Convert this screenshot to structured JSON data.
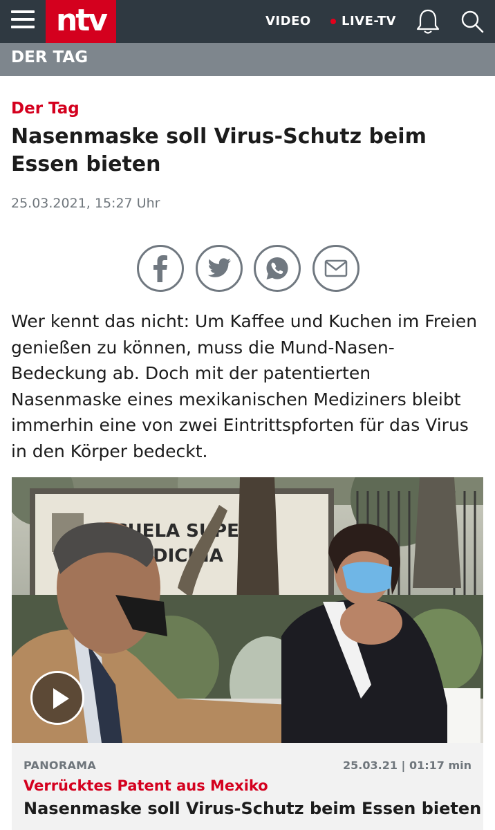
{
  "header": {
    "logo_text": "ntv",
    "nav_video": "VIDEO",
    "nav_live": "LIVE-TV",
    "colors": {
      "bar": "#2f3941",
      "brand_red": "#d4001e"
    },
    "icons": [
      "menu-icon",
      "bell-icon",
      "search-icon"
    ]
  },
  "section": {
    "label": "DER TAG"
  },
  "article": {
    "kicker": "Der Tag",
    "headline": "Nasenmaske soll Virus-Schutz beim Essen bieten",
    "date": "25.03.2021, 15:27 Uhr",
    "share_icons": [
      "facebook-icon",
      "twitter-icon",
      "whatsapp-icon",
      "mail-icon"
    ],
    "teaser": "Wer kennt das nicht: Um Kaffee und Kuchen im Freien genießen zu können, muss die Mund-Nasen-Bedeckung ab. Doch mit der patentierten Nasenmaske eines mexikanischen Mediziners bleibt immerhin eine von zwei Eintrittspforten für das Virus in den Körper bedeckt."
  },
  "video_card": {
    "sign_line1": "ESCUELA SUPER",
    "sign_line2": "DE MEDICINA",
    "category": "PANORAMA",
    "meta": "25.03.21 | 01:17 min",
    "kicker": "Verrücktes Patent aus Mexiko",
    "title": "Nasenmaske soll Virus-Schutz beim Essen bieten"
  }
}
